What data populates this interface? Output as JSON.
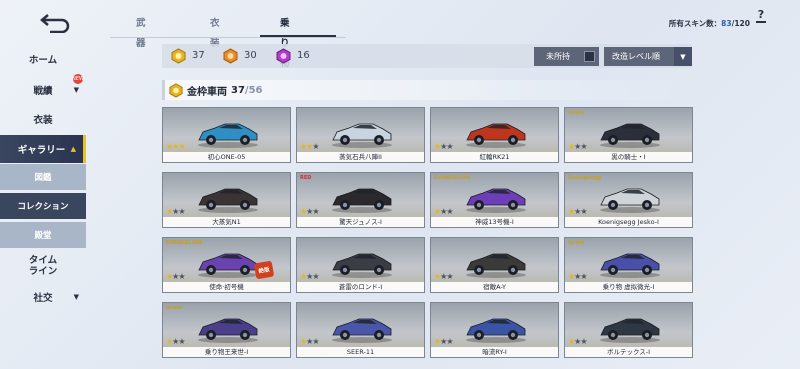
{
  "nav": {
    "items": [
      {
        "label": "ホーム"
      },
      {
        "label": "戦績"
      },
      {
        "label": "衣装"
      },
      {
        "label": "ギャラリー"
      },
      {
        "label": "図鑑"
      },
      {
        "label": "コレクション"
      },
      {
        "label": "殿堂"
      },
      {
        "label": "タイム\nライン"
      },
      {
        "label": "社交"
      }
    ],
    "new_badge": "NEW"
  },
  "tabs": [
    {
      "label": "武器"
    },
    {
      "label": "衣装"
    },
    {
      "label": "乗り物"
    }
  ],
  "skin_count": {
    "label": "所有スキン数：",
    "owned": "83",
    "total": "/120"
  },
  "filter": {
    "coins": [
      {
        "color": "gold",
        "count": "37"
      },
      {
        "color": "orange",
        "count": "30"
      },
      {
        "color": "purple",
        "count": "16"
      }
    ],
    "owned_label": "未所持",
    "sort_label": "改造レベル順"
  },
  "section": {
    "title": "金枠車両",
    "owned": "37",
    "total": "/56"
  },
  "cards": [
    {
      "name": "初心ONE-05",
      "stars": 3,
      "body": "#2f8fc4",
      "logo": ""
    },
    {
      "name": "蒸気石兵八陣II",
      "stars": 2,
      "body": "#c8d4e0",
      "logo": ""
    },
    {
      "name": "紅輪RK21",
      "stars": 1,
      "body": "#c0351e",
      "logo": ""
    },
    {
      "name": "黒の騎士・I",
      "stars": 1,
      "body": "#2a2f3a",
      "logo": "lorem"
    },
    {
      "name": "大蒸気N1",
      "stars": 1,
      "body": "#3a3434",
      "logo": ""
    },
    {
      "name": "驚天ジュノス-I",
      "stars": 1,
      "body": "#2a2a2e",
      "logo": "RED"
    },
    {
      "name": "神威13号機-I",
      "stars": 1,
      "body": "#6c3fb8",
      "logo": "EVANGELION"
    },
    {
      "name": "Koenigsegg Jesko-I",
      "stars": 1,
      "body": "#cfd4d9",
      "logo": "Koenigsegg"
    },
    {
      "name": "使命·初号機",
      "stars": 1,
      "body": "#6b43b0",
      "logo": "EVANGELION",
      "tag": "絶版"
    },
    {
      "name": "蒼雷のロンド-I",
      "stars": 1,
      "body": "#3a3d44",
      "logo": ""
    },
    {
      "name": "宿敵A-Y",
      "stars": 1,
      "body": "#3a3a38",
      "logo": ""
    },
    {
      "name": "乗り物 虚拟微光-I",
      "stars": 1,
      "body": "#4a4fa8",
      "logo": "lorem"
    },
    {
      "name": "乗り物王来世-I",
      "stars": 1,
      "body": "#4a3f8a",
      "logo": "lorem"
    },
    {
      "name": "SEER-11",
      "stars": 1,
      "body": "#4a56a8",
      "logo": ""
    },
    {
      "name": "暗流RY-I",
      "stars": 1,
      "body": "#3a55a6",
      "logo": ""
    },
    {
      "name": "ボルテックス-I",
      "stars": 1,
      "body": "#2f3842",
      "logo": ""
    }
  ]
}
